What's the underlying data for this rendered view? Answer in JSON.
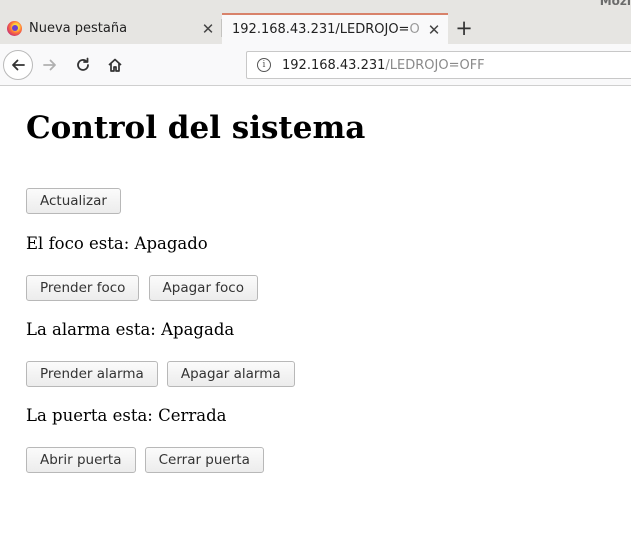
{
  "window": {
    "app_title": "Mozi"
  },
  "tabs": [
    {
      "label": "Nueva pestaña",
      "active": false
    },
    {
      "label_host": "192.168.43.231/LEDROJO=",
      "label_fade": "O",
      "active": true
    }
  ],
  "nav": {
    "new_tab_symbol": "+"
  },
  "address": {
    "host": "192.168.43.231",
    "path": "/LEDROJO=OFF"
  },
  "page": {
    "title": "Control del sistema",
    "refresh_label": "Actualizar",
    "sections": [
      {
        "status": "El foco esta: Apagado",
        "on_label": "Prender foco",
        "off_label": "Apagar foco"
      },
      {
        "status": "La alarma esta: Apagada",
        "on_label": "Prender alarma",
        "off_label": "Apagar alarma"
      },
      {
        "status": "La puerta esta: Cerrada",
        "on_label": "Abrir puerta",
        "off_label": "Cerrar puerta"
      }
    ]
  }
}
